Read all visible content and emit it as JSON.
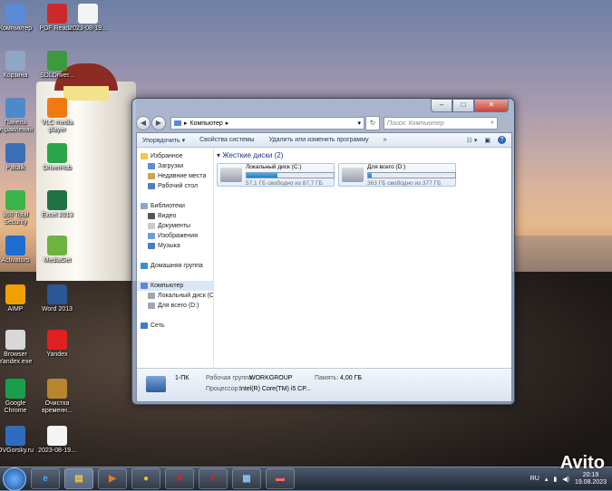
{
  "desktop_icons": [
    {
      "label": "Компьютер",
      "icon": "computer-icon",
      "color": "#5b8ad6"
    },
    {
      "label": "PDF Reader",
      "icon": "pdf-icon",
      "color": "#cc2a2a"
    },
    {
      "label": "2023-08-19...",
      "icon": "image-file-icon",
      "color": "#f4f4f4"
    },
    {
      "label": "Корзина",
      "icon": "recycle-bin-icon",
      "color": "#8fa6c4"
    },
    {
      "label": "SDLDriver...",
      "icon": "sdl-icon",
      "color": "#3c9a3c"
    },
    {
      "label": "Панель управления",
      "icon": "control-panel-icon",
      "color": "#4e89c9"
    },
    {
      "label": "VLC media player",
      "icon": "vlc-icon",
      "color": "#f07a12"
    },
    {
      "label": "Paltalk",
      "icon": "paltalk-icon",
      "color": "#3b6fb5"
    },
    {
      "label": "DriverHub",
      "icon": "driverhub-icon",
      "color": "#2aa64a"
    },
    {
      "label": "360 Total Security",
      "icon": "security-icon",
      "color": "#3ab54a"
    },
    {
      "label": "Excel 2013",
      "icon": "excel-icon",
      "color": "#207245"
    },
    {
      "label": "Activators",
      "icon": "activators-icon",
      "color": "#1c6ed0"
    },
    {
      "label": "MediaGet",
      "icon": "mediaget-icon",
      "color": "#6cb33f"
    },
    {
      "label": "AIMP",
      "icon": "aimp-icon",
      "color": "#f0a000"
    },
    {
      "label": "Word 2013",
      "icon": "word-icon",
      "color": "#2b5797"
    },
    {
      "label": "Browser Yandex.exe",
      "icon": "installer-icon",
      "color": "#d8d8d8"
    },
    {
      "label": "Yandex",
      "icon": "yandex-icon",
      "color": "#e02020"
    },
    {
      "label": "Google Chrome",
      "icon": "chrome-icon",
      "color": "#1a9e4c"
    },
    {
      "label": "Очистка временн...",
      "icon": "broom-icon",
      "color": "#b7862c"
    },
    {
      "label": "OVGorsky.ru",
      "icon": "ovgorsky-icon",
      "color": "#2d6cc0"
    },
    {
      "label": "2023-08-19...",
      "icon": "image-file-icon",
      "color": "#f4f4f4"
    }
  ],
  "window": {
    "address": "Компьютер",
    "search_placeholder": "Поиск: Компьютер",
    "toolbar": {
      "organize": "Упорядочить",
      "system_props": "Свойства системы",
      "uninstall": "Удалить или изменить программу",
      "more": "»"
    },
    "nav": {
      "favorites": "Избранное",
      "downloads": "Загрузки",
      "recent": "Недавние места",
      "desktop": "Рабочий стол",
      "libraries": "Библиотеки",
      "video": "Видео",
      "documents": "Документы",
      "images": "Изображения",
      "music": "Музыка",
      "homegroup": "Домашняя группа",
      "computer": "Компьютер",
      "local_disk": "Локальный диск (C",
      "all_disk": "Для всего (D:)",
      "network": "Сеть"
    },
    "group_title": "Жесткие диски (2)",
    "drives": [
      {
        "name": "Локальный диск (C:)",
        "free_text": "57,1 ГБ свободно из 87,7 ГБ",
        "used_fraction": 0.35
      },
      {
        "name": "Для всего (D:)",
        "free_text": "363 ГБ свободно из 377 ГБ",
        "used_fraction": 0.04
      }
    ],
    "details": {
      "pc_name": "1-ПК",
      "workgroup_label": "Рабочая группа:",
      "workgroup_value": "WORKGROUP",
      "memory_label": "Память:",
      "memory_value": "4,00 ГБ",
      "cpu_label": "Процессор:",
      "cpu_value": "Intel(R) Core(TM) i5 CP..."
    }
  },
  "taskbar": {
    "lang": "RU",
    "time": "20:19",
    "date": "19.08.2023"
  },
  "watermark": "Avito"
}
